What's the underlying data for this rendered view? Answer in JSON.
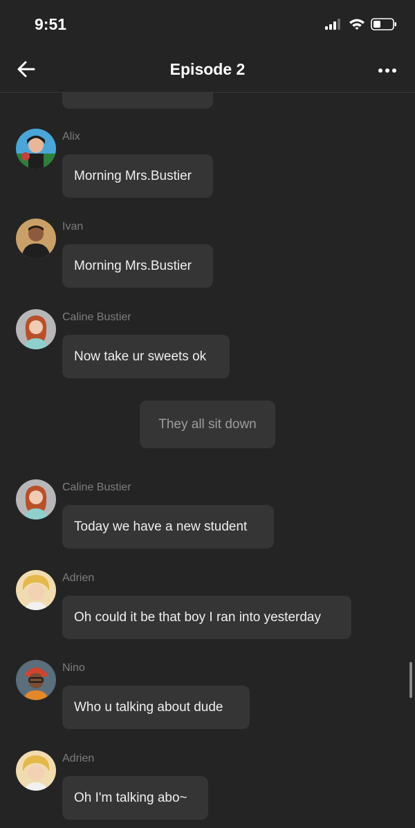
{
  "status_bar": {
    "time": "9:51"
  },
  "header": {
    "title": "Episode 2",
    "back_icon": "arrow-left-icon",
    "more_icon": "more-horizontal-icon"
  },
  "messages": [
    {
      "sender": "Alix",
      "text": "Morning Mrs.Bustier"
    },
    {
      "sender": "Ivan",
      "text": "Morning Mrs.Bustier"
    },
    {
      "sender": "Caline Bustier",
      "text": "Now take ur sweets ok"
    },
    {
      "sender": "Caline Bustier",
      "text": "Today we have a new student"
    },
    {
      "sender": "Adrien",
      "text": "Oh could it be that boy I ran into yesterday"
    },
    {
      "sender": "Nino",
      "text": "Who u talking about dude"
    },
    {
      "sender": "Adrien",
      "text": "Oh I'm talking abo~"
    }
  ],
  "narration": {
    "text": "They all sit down"
  },
  "colors": {
    "background": "#242424",
    "bubble": "#353535",
    "sender_text": "#7e7e7e",
    "message_text": "#efefef",
    "narration_text": "#9d9d9d"
  }
}
